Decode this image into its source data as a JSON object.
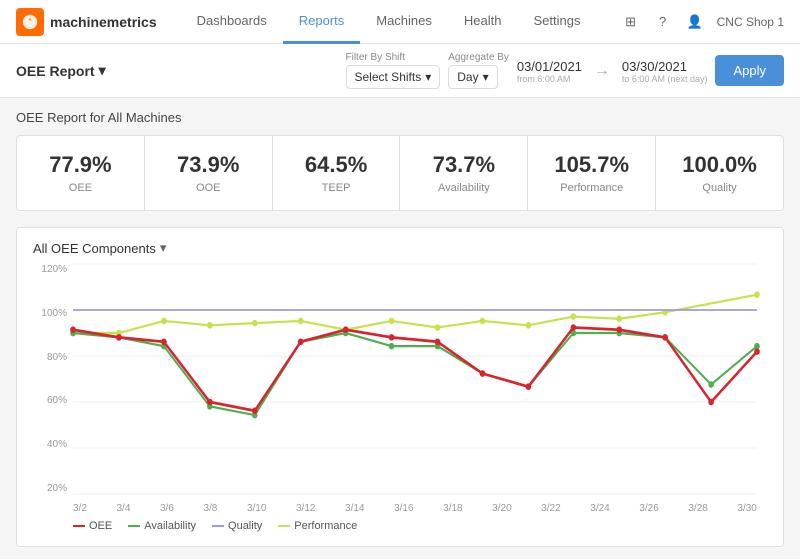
{
  "app": {
    "logo_text": "machinemetrics",
    "shop_name": "CNC Shop 1"
  },
  "nav": {
    "links": [
      {
        "id": "dashboards",
        "label": "Dashboards",
        "active": false
      },
      {
        "id": "reports",
        "label": "Reports",
        "active": true
      },
      {
        "id": "machines",
        "label": "Machines",
        "active": false
      },
      {
        "id": "health",
        "label": "Health",
        "active": false
      },
      {
        "id": "settings",
        "label": "Settings",
        "active": false
      }
    ]
  },
  "toolbar": {
    "report_label": "OEE Report",
    "filter_by_shift_label": "Filter By Shift",
    "select_shifts_label": "Select Shifts",
    "aggregate_by_label": "Aggregate By",
    "aggregate_day_label": "Day",
    "from_date": "03/01/2021",
    "from_sublabel": "from 6:00 AM",
    "to_date": "03/30/2021",
    "to_sublabel": "to 6:00 AM (next day)",
    "apply_label": "Apply"
  },
  "report": {
    "section_title": "OEE Report for All Machines",
    "metrics": [
      {
        "id": "oee",
        "value": "77.9%",
        "label": "OEE"
      },
      {
        "id": "ooe",
        "value": "73.9%",
        "label": "OOE"
      },
      {
        "id": "teep",
        "value": "64.5%",
        "label": "TEEP"
      },
      {
        "id": "availability",
        "value": "73.7%",
        "label": "Availability"
      },
      {
        "id": "performance",
        "value": "105.7%",
        "label": "Performance"
      },
      {
        "id": "quality",
        "value": "100.0%",
        "label": "Quality"
      }
    ]
  },
  "chart": {
    "title": "All OEE Components",
    "y_labels": [
      "120%",
      "100%",
      "80%",
      "60%",
      "40%",
      "20%"
    ],
    "x_labels": [
      "3/2",
      "3/4",
      "3/6",
      "3/8",
      "3/10",
      "3/12",
      "3/14",
      "3/16",
      "3/18",
      "3/20",
      "3/22",
      "3/24",
      "3/26",
      "3/28",
      "3/30"
    ],
    "legend": [
      {
        "id": "oee",
        "label": "OEE",
        "color": "#d9232d"
      },
      {
        "id": "availability",
        "label": "Availability",
        "color": "#4caf50"
      },
      {
        "id": "quality",
        "label": "Quality",
        "color": "#9c9ce0"
      },
      {
        "id": "performance",
        "label": "Performance",
        "color": "#c8e04a"
      }
    ],
    "colors": {
      "oee": "#d9232d",
      "availability": "#4caf50",
      "quality": "#9c9ce0",
      "performance": "#c8e04a"
    }
  }
}
